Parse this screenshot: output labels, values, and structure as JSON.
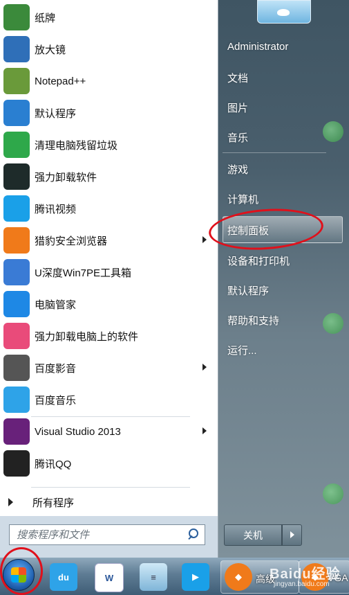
{
  "programs": [
    {
      "label": "纸牌",
      "icon": "solitaire-icon",
      "color": "#3b8a3b"
    },
    {
      "label": "放大镜",
      "icon": "magnifier-icon",
      "color": "#2f6fb8"
    },
    {
      "label": "Notepad++",
      "icon": "notepadpp-icon",
      "color": "#6a9a3a"
    },
    {
      "label": "默认程序",
      "icon": "default-programs-icon",
      "color": "#2a7fd1"
    },
    {
      "label": "清理电脑残留垃圾",
      "icon": "recycle-icon",
      "color": "#2ea84a"
    },
    {
      "label": "强力卸载软件",
      "icon": "uninstaller-icon",
      "color": "#1e2b2a"
    },
    {
      "label": "腾讯视频",
      "icon": "tencent-video-icon",
      "color": "#1aa0e8"
    },
    {
      "label": "猎豹安全浏览器",
      "icon": "cheetah-browser-icon",
      "color": "#f07a1a"
    },
    {
      "label": "U深度Win7PE工具箱",
      "icon": "usb-tool-icon",
      "color": "#3a7bd5"
    },
    {
      "label": "电脑管家",
      "icon": "pc-manager-icon",
      "color": "#1e88e5"
    },
    {
      "label": "强力卸载电脑上的软件",
      "icon": "flower-uninstaller-icon",
      "color": "#e94b7a"
    },
    {
      "label": "百度影音",
      "icon": "baidu-player-icon",
      "color": "#555555"
    },
    {
      "label": "百度音乐",
      "icon": "baidu-music-icon",
      "color": "#2ea3e8"
    },
    {
      "label": "Visual Studio 2013",
      "icon": "visual-studio-icon",
      "color": "#68217a"
    },
    {
      "label": "腾讯QQ",
      "icon": "qq-icon",
      "color": "#222222"
    }
  ],
  "all_programs_label": "所有程序",
  "search": {
    "placeholder": "搜索程序和文件"
  },
  "right_items": {
    "user": "Administrator",
    "documents": "文档",
    "pictures": "图片",
    "music": "音乐",
    "games": "游戏",
    "computer": "计算机",
    "control_panel": "控制面板",
    "devices_printers": "设备和打印机",
    "default_programs": "默认程序",
    "help_support": "帮助和支持",
    "run": "运行..."
  },
  "shutdown_label": "关机",
  "taskbar": {
    "app1": "高级",
    "app2": "VGA",
    "watermark": "Baidu经验",
    "watermark_url": "jingyan.baidu.com"
  },
  "colors": {
    "highlight_ring": "#e0101b",
    "taskbar": "#3f5d76"
  }
}
